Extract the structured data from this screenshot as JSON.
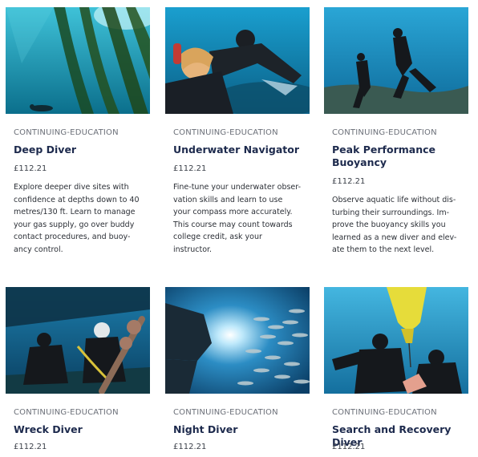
{
  "courses": [
    {
      "category": "CONTINUING-EDUCATION",
      "title": "Deep Diver",
      "price": "£112.21",
      "description": "Explore deeper dive sites with confidence at depths down to 40 metres/130 ft. Learn to manage your gas supply, go over buddy contact procedures, and buoy-ancy control."
    },
    {
      "category": "CONTINUING-EDUCATION",
      "title": "Underwater Navigator",
      "price": "£112.21",
      "description": "Fine-tune your underwater obser-vation skills and learn to use your compass more accurately. This course may count towards college credit, ask your instructor."
    },
    {
      "category": "CONTINUING-EDUCATION",
      "title": "Peak Performance Buoyancy",
      "price": "£112.21",
      "description": "Observe aquatic life without dis-turbing their surroundings. Im-prove the buoyancy skills you learned as a new diver and elev-ate them to the next level."
    },
    {
      "category": "CONTINUING-EDUCATION",
      "title": "Wreck Diver",
      "price": "£112.21",
      "description": ""
    },
    {
      "category": "CONTINUING-EDUCATION",
      "title": "Night Diver",
      "price": "£112.21",
      "description": ""
    },
    {
      "category": "CONTINUING-EDUCATION",
      "title": "Search and Recovery Diver",
      "price": "£112.21",
      "description": ""
    }
  ],
  "colors": {
    "title": "#1d2a4d",
    "category": "#6b6f78",
    "ocean": "#1a7fb0"
  }
}
